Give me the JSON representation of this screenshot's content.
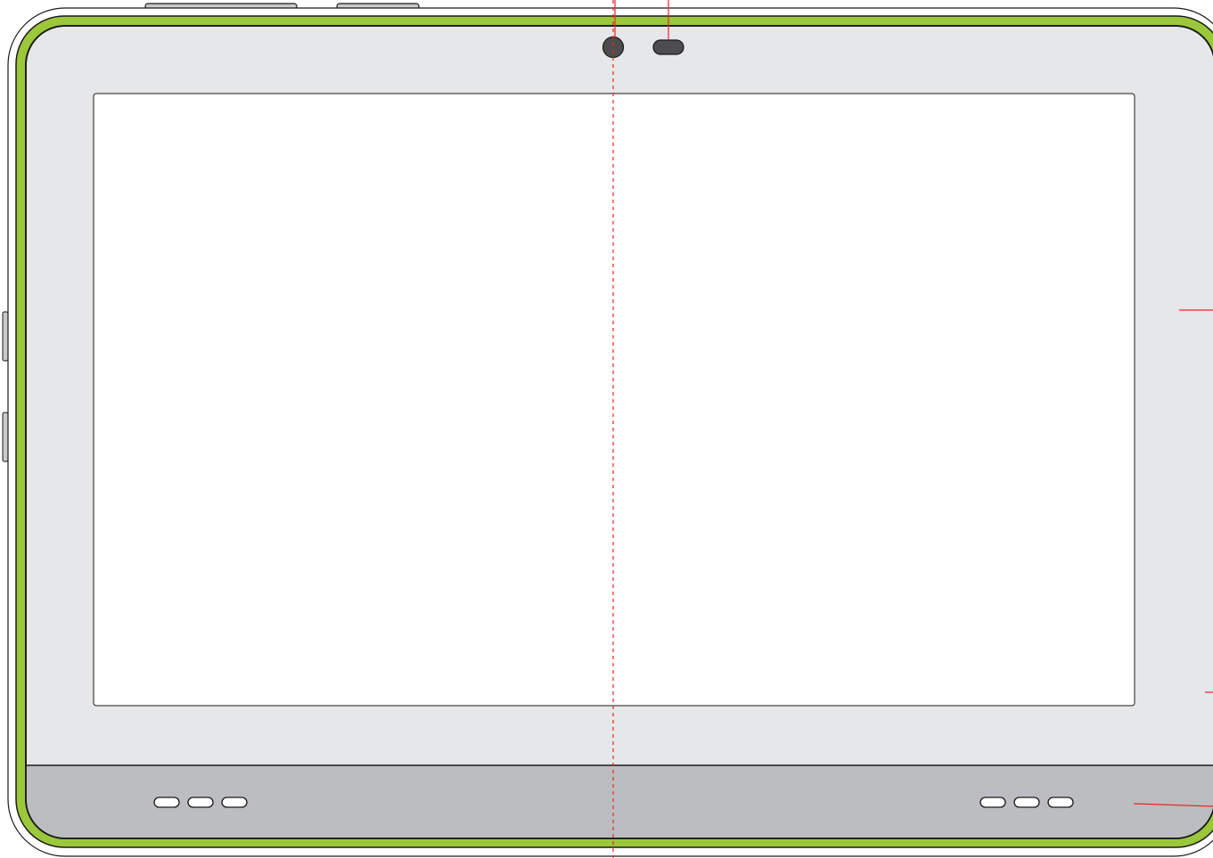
{
  "device": {
    "type": "tablet",
    "view": "front",
    "colors": {
      "background": "#ffffff",
      "outline": "#1a1a1a",
      "bumper": "#9bc83a",
      "bezel": "#e6e7e8",
      "screen": "#ffffff",
      "chin": "#bcbdc0",
      "lens": "#4d4d4f",
      "annotation": "#e8262b"
    },
    "top_buttons": [
      "power-button",
      "volume-button"
    ],
    "speaker_groups": [
      {
        "name": "left-speaker",
        "slots": 3
      },
      {
        "name": "right-speaker",
        "slots": 3
      }
    ],
    "annotations": {
      "center_line": "dashed",
      "leader_lines": [
        "camera-leader",
        "sensor-leader",
        "right-edge-leader",
        "lower-right-leader",
        "chin-leader"
      ]
    }
  }
}
